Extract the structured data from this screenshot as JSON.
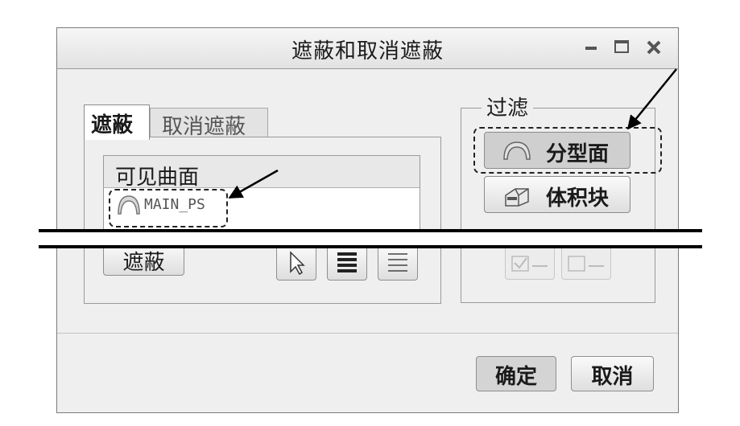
{
  "dialog": {
    "title": "遮蔽和取消遮蔽",
    "window_controls": {
      "minimize": "-",
      "maximize": "□",
      "close": "x"
    }
  },
  "tabs": [
    {
      "label": "遮蔽",
      "active": true
    },
    {
      "label": "取消遮蔽",
      "active": false
    }
  ],
  "list": {
    "header": "可见曲面",
    "items": [
      {
        "label": "MAIN_PS",
        "icon": "surface-icon"
      }
    ]
  },
  "actions": {
    "hide_label": "遮蔽",
    "icons": [
      "select-pointer-icon",
      "select-all-icon",
      "select-none-icon"
    ]
  },
  "filter": {
    "legend": "过滤",
    "buttons": [
      {
        "label": "分型面",
        "icon": "parting-surface-icon",
        "pressed": true
      },
      {
        "label": "体积块",
        "icon": "volume-block-icon",
        "pressed": false
      }
    ],
    "checkbox_icons": [
      "check-all-icon",
      "uncheck-all-icon"
    ]
  },
  "footer": {
    "ok_label": "确定",
    "cancel_label": "取消"
  }
}
